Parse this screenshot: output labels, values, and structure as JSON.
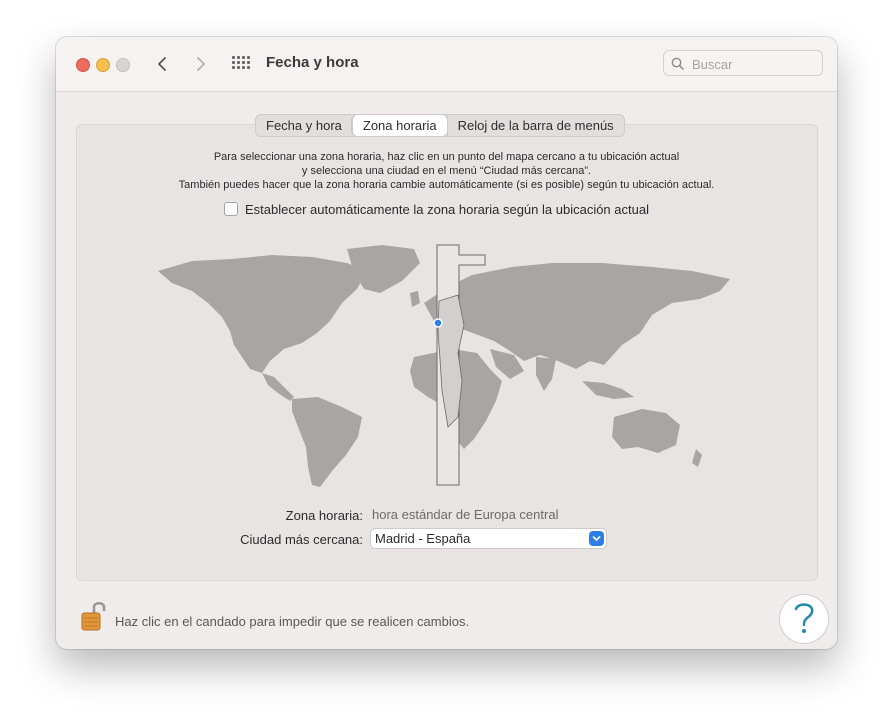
{
  "window": {
    "title": "Fecha y hora",
    "search_placeholder": "Buscar"
  },
  "tabs": [
    {
      "label": "Fecha y hora",
      "active": false
    },
    {
      "label": "Zona horaria",
      "active": true
    },
    {
      "label": "Reloj de la barra de menús",
      "active": false
    }
  ],
  "description": {
    "line1": "Para seleccionar una zona horaria, haz clic en un punto del mapa cercano a tu ubicación actual",
    "line2": "y selecciona una ciudad en el menú “Ciudad más cercana”.",
    "line3": "También puedes hacer que la zona horaria cambie automáticamente (si es posible) según tu ubicación actual."
  },
  "auto_timezone": {
    "label": "Establecer automáticamente la zona horaria según la ubicación actual",
    "checked": false
  },
  "timezone": {
    "label": "Zona horaria:",
    "value": "hora estándar de Europa central"
  },
  "closest_city": {
    "label": "Ciudad más cercana:",
    "value": "Madrid - España"
  },
  "footer": {
    "lock_text": "Haz clic en el candado para impedir que se realicen cambios."
  },
  "icons": [
    "search-icon",
    "chevron-left-icon",
    "chevron-right-icon",
    "grid-icon",
    "lock-icon",
    "help-icon",
    "chevron-updown-icon"
  ],
  "colors": {
    "accent": "#2f7ee8",
    "close": "#ed6a5e",
    "minimize": "#f5bf4f",
    "zoom_inactive": "#d9d5d5",
    "map_land": "#a9a5a5",
    "map_selected_zone": "#d2cfcf"
  }
}
